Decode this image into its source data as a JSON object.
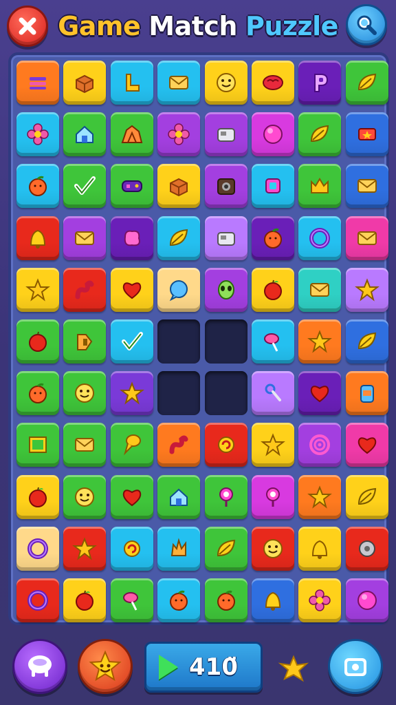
{
  "title": {
    "part1": "Game",
    "part2": "Match",
    "part3": "Puzzle"
  },
  "score": "410̈",
  "colors": {
    "orange": "#ff7a1f",
    "yellow": "#ffd11a",
    "cyan": "#24c0f0",
    "purple": "#a33fe0",
    "green": "#3fc53a",
    "blue": "#2f6fe0",
    "pink": "#f03aa8",
    "red": "#e8291c",
    "magenta": "#d83ae0",
    "teal": "#2fd0c4",
    "beige": "#ffd98a",
    "darkpurple": "#6a1fb8",
    "lime": "#8fd41f",
    "lightpurple": "#b97aff",
    "violet": "#7a3ad8"
  },
  "board": {
    "rows": [
      [
        {
          "c": "orange",
          "i": "bars-icon"
        },
        {
          "c": "yellow",
          "i": "box-icon"
        },
        {
          "c": "cyan",
          "i": "arrow-icon"
        },
        {
          "c": "cyan",
          "i": "envelope-icon"
        },
        {
          "c": "yellow",
          "i": "face-icon"
        },
        {
          "c": "yellow",
          "i": "brain-icon"
        },
        {
          "c": "darkpurple",
          "i": "letter-p-icon"
        },
        {
          "c": "green",
          "i": "leaf-icon"
        }
      ],
      [
        {
          "c": "cyan",
          "i": "flower-icon"
        },
        {
          "c": "green",
          "i": "house-icon"
        },
        {
          "c": "green",
          "i": "rock-icon"
        },
        {
          "c": "purple",
          "i": "flower-icon"
        },
        {
          "c": "purple",
          "i": "machine-icon"
        },
        {
          "c": "magenta",
          "i": "orb-icon"
        },
        {
          "c": "green",
          "i": "leaf-icon"
        },
        {
          "c": "blue",
          "i": "badge-icon"
        }
      ],
      [
        {
          "c": "cyan",
          "i": "fruit-icon"
        },
        {
          "c": "green",
          "i": "check-icon"
        },
        {
          "c": "green",
          "i": "gamepad-icon"
        },
        {
          "c": "yellow",
          "i": "box-icon"
        },
        {
          "c": "purple",
          "i": "camera-icon"
        },
        {
          "c": "cyan",
          "i": "square-icon"
        },
        {
          "c": "green",
          "i": "crown-icon"
        },
        {
          "c": "blue",
          "i": "envelope-icon"
        }
      ],
      [
        {
          "c": "red",
          "i": "bell-icon"
        },
        {
          "c": "purple",
          "i": "envelope-icon"
        },
        {
          "c": "darkpurple",
          "i": "blob-icon"
        },
        {
          "c": "cyan",
          "i": "leaf-icon"
        },
        {
          "c": "lightpurple",
          "i": "machine-icon"
        },
        {
          "c": "darkpurple",
          "i": "fruit-icon"
        },
        {
          "c": "cyan",
          "i": "ring-icon"
        },
        {
          "c": "pink",
          "i": "envelope-icon"
        }
      ],
      [
        {
          "c": "yellow",
          "i": "star-icon"
        },
        {
          "c": "red",
          "i": "worm-icon"
        },
        {
          "c": "yellow",
          "i": "heart-icon"
        },
        {
          "c": "beige",
          "i": "bubble-icon"
        },
        {
          "c": "purple",
          "i": "alien-icon"
        },
        {
          "c": "yellow",
          "i": "apple-icon"
        },
        {
          "c": "teal",
          "i": "envelope-icon"
        },
        {
          "c": "lightpurple",
          "i": "star-icon"
        }
      ],
      [
        {
          "c": "green",
          "i": "apple-icon"
        },
        {
          "c": "green",
          "i": "tag-icon"
        },
        {
          "c": "cyan",
          "i": "check-icon"
        },
        {
          "c": "empty",
          "i": ""
        },
        {
          "c": "empty",
          "i": ""
        },
        {
          "c": "cyan",
          "i": "candy-icon"
        },
        {
          "c": "orange",
          "i": "star-icon"
        },
        {
          "c": "blue",
          "i": "leaf-icon"
        }
      ],
      [
        {
          "c": "green",
          "i": "fruit-icon"
        },
        {
          "c": "green",
          "i": "face-icon"
        },
        {
          "c": "violet",
          "i": "star-icon"
        },
        {
          "c": "empty",
          "i": ""
        },
        {
          "c": "empty",
          "i": ""
        },
        {
          "c": "lightpurple",
          "i": "key-icon"
        },
        {
          "c": "darkpurple",
          "i": "heart-icon"
        },
        {
          "c": "orange",
          "i": "jar-icon"
        }
      ],
      [
        {
          "c": "green",
          "i": "frame-icon"
        },
        {
          "c": "green",
          "i": "envelope-icon"
        },
        {
          "c": "green",
          "i": "cone-icon"
        },
        {
          "c": "orange",
          "i": "worm-icon"
        },
        {
          "c": "red",
          "i": "swirl-icon"
        },
        {
          "c": "yellow",
          "i": "star-icon"
        },
        {
          "c": "purple",
          "i": "target-icon"
        },
        {
          "c": "pink",
          "i": "heart-icon"
        }
      ],
      [
        {
          "c": "yellow",
          "i": "apple-icon"
        },
        {
          "c": "green",
          "i": "face-icon"
        },
        {
          "c": "green",
          "i": "heart-icon"
        },
        {
          "c": "green",
          "i": "house-icon"
        },
        {
          "c": "green",
          "i": "pin-icon"
        },
        {
          "c": "magenta",
          "i": "pin-icon"
        },
        {
          "c": "orange",
          "i": "star-icon"
        },
        {
          "c": "yellow",
          "i": "leaf-icon"
        }
      ],
      [
        {
          "c": "beige",
          "i": "ring-icon"
        },
        {
          "c": "red",
          "i": "star-icon"
        },
        {
          "c": "cyan",
          "i": "swirl-icon"
        },
        {
          "c": "cyan",
          "i": "splash-icon"
        },
        {
          "c": "green",
          "i": "leaf-icon"
        },
        {
          "c": "red",
          "i": "face-icon"
        },
        {
          "c": "yellow",
          "i": "bell-icon"
        },
        {
          "c": "red",
          "i": "gear-icon"
        }
      ],
      [
        {
          "c": "red",
          "i": "ring-icon"
        },
        {
          "c": "yellow",
          "i": "apple-icon"
        },
        {
          "c": "green",
          "i": "candy-icon"
        },
        {
          "c": "cyan",
          "i": "fruit-icon"
        },
        {
          "c": "green",
          "i": "fruit-icon"
        },
        {
          "c": "blue",
          "i": "bell-icon"
        },
        {
          "c": "yellow",
          "i": "flower-icon"
        },
        {
          "c": "purple",
          "i": "orb-icon"
        }
      ]
    ]
  },
  "bottom": {
    "shop_icon": "basket-icon",
    "star_icon": "star-face-icon",
    "camera_icon": "camera-icon",
    "bonus_icon": "star-icon"
  }
}
